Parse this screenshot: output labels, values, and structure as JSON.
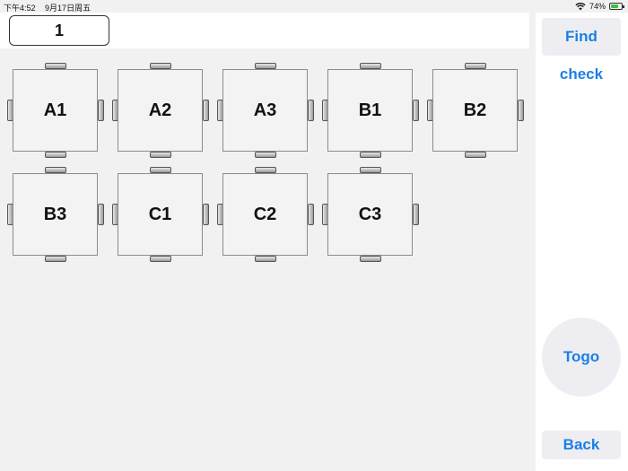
{
  "status": {
    "time": "下午4:52",
    "date": "9月17日周五",
    "battery": "74%",
    "battery_level": 0.74
  },
  "table_input": {
    "value": "1"
  },
  "sidebar": {
    "find_check": "Find check",
    "togo": "Togo",
    "back": "Back"
  },
  "tables": [
    {
      "label": "A1"
    },
    {
      "label": "A2"
    },
    {
      "label": "A3"
    },
    {
      "label": "B1"
    },
    {
      "label": "B2"
    },
    {
      "label": "B3"
    },
    {
      "label": "C1"
    },
    {
      "label": "C2"
    },
    {
      "label": "C3"
    }
  ],
  "colors": {
    "accent": "#1b7fe6",
    "background": "#f1f1f1",
    "panel": "#ffffff"
  }
}
